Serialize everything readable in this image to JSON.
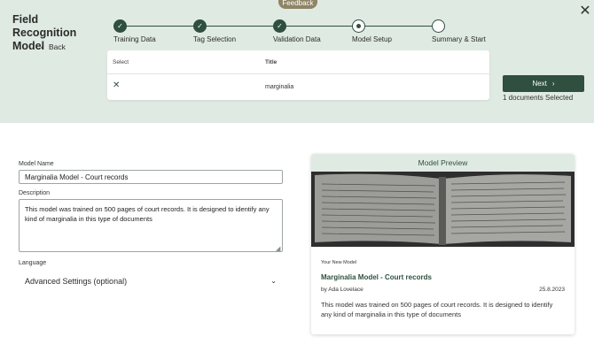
{
  "header": {
    "feedback_label": "Feedback",
    "title": "Field Recognition Model",
    "back_label": "Back",
    "close_icon": "close-icon"
  },
  "stepper": {
    "steps": [
      {
        "label": "Training Data",
        "state": "done"
      },
      {
        "label": "Tag Selection",
        "state": "done"
      },
      {
        "label": "Validation Data",
        "state": "done"
      },
      {
        "label": "Model Setup",
        "state": "current"
      },
      {
        "label": "Summary & Start",
        "state": "todo"
      }
    ]
  },
  "table": {
    "columns": [
      "Select",
      "Title"
    ],
    "rows": [
      {
        "title": "marginalia"
      }
    ]
  },
  "actions": {
    "next_label": "Next",
    "selected_count": "1 documents Selected"
  },
  "form": {
    "model_name_label": "Model Name",
    "model_name_value": "Marginalia Model - Court records",
    "description_label": "Description",
    "description_value": "This model was trained on 500 pages of court records. It is designed to identify any kind of marginalia in this type of documents",
    "language_label": "Language",
    "advanced_label": "Advanced Settings (optional)"
  },
  "preview": {
    "heading": "Model Preview",
    "subheading": "Your New Model",
    "title": "Marginalia Model - Court records",
    "author": "by Ada Lovelace",
    "date": "25.8.2023",
    "description": "This model was trained on 500 pages of court records. It is designed to identify any kind of marginalia in this type of documents"
  },
  "colors": {
    "accent": "#2f4f3f",
    "panel": "#dfeae3"
  }
}
